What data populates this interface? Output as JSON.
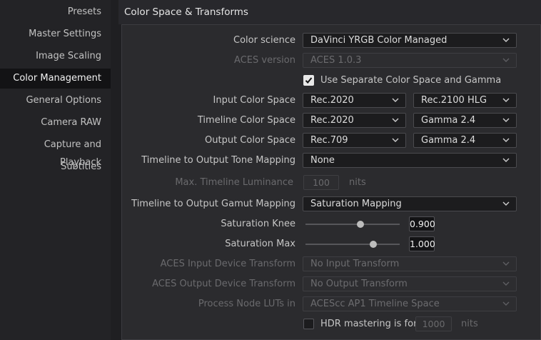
{
  "sidebar": {
    "items": [
      {
        "label": "Presets"
      },
      {
        "label": "Master Settings"
      },
      {
        "label": "Image Scaling"
      },
      {
        "label": "Color Management"
      },
      {
        "label": "General Options"
      },
      {
        "label": "Camera RAW"
      },
      {
        "label": "Capture and Playback"
      },
      {
        "label": "Subtitles"
      }
    ],
    "active": "Color Management"
  },
  "section": {
    "title": "Color Space & Transforms"
  },
  "form": {
    "color_science": {
      "label": "Color science",
      "value": "DaVinci YRGB Color Managed"
    },
    "aces_version": {
      "label": "ACES version",
      "value": "ACES 1.0.3",
      "enabled": false
    },
    "separate_cs_gamma": {
      "label": "Use Separate Color Space and Gamma",
      "checked": true
    },
    "input_color_space": {
      "label": "Input Color Space",
      "space": "Rec.2020",
      "gamma": "Rec.2100 HLG"
    },
    "timeline_color_space": {
      "label": "Timeline Color Space",
      "space": "Rec.2020",
      "gamma": "Gamma 2.4"
    },
    "output_color_space": {
      "label": "Output Color Space",
      "space": "Rec.709",
      "gamma": "Gamma 2.4"
    },
    "tone_mapping": {
      "label": "Timeline to Output Tone Mapping",
      "value": "None"
    },
    "max_luminance": {
      "label": "Max. Timeline Luminance",
      "value": "100",
      "unit": "nits",
      "enabled": false
    },
    "gamut_mapping": {
      "label": "Timeline to Output Gamut Mapping",
      "value": "Saturation Mapping"
    },
    "saturation_knee": {
      "label": "Saturation Knee",
      "value": "0.900",
      "slider_fraction": 0.58
    },
    "saturation_max": {
      "label": "Saturation Max",
      "value": "1.000",
      "slider_fraction": 0.72
    },
    "aces_idt": {
      "label": "ACES Input Device Transform",
      "value": "No Input Transform",
      "enabled": false
    },
    "aces_odt": {
      "label": "ACES Output Device Transform",
      "value": "No Output Transform",
      "enabled": false
    },
    "process_node_luts": {
      "label": "Process Node LUTs in",
      "value": "ACEScc AP1 Timeline Space",
      "enabled": false
    },
    "hdr_mastering": {
      "label": "HDR mastering is for",
      "value": "1000",
      "unit": "nits",
      "checked": false
    }
  },
  "icons": {
    "dropdown": "chevron-down-icon",
    "check": "checkmark-icon"
  }
}
